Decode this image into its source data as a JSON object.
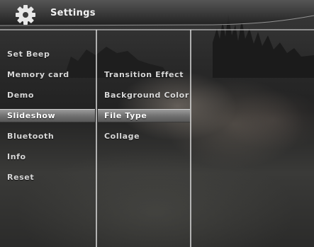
{
  "header": {
    "title": "Settings",
    "icon": "gear-icon"
  },
  "main_menu": {
    "items": [
      {
        "label": "Set Beep",
        "selected": false
      },
      {
        "label": "Memory card",
        "selected": false
      },
      {
        "label": "Demo",
        "selected": false
      },
      {
        "label": "Slideshow",
        "selected": true
      },
      {
        "label": "Bluetooth",
        "selected": false
      },
      {
        "label": "Info",
        "selected": false
      },
      {
        "label": "Reset",
        "selected": false
      }
    ]
  },
  "sub_menu": {
    "items": [
      {
        "label": "Transition Effect",
        "selected": false
      },
      {
        "label": "Background Color",
        "selected": false
      },
      {
        "label": "File Type",
        "selected": true
      },
      {
        "label": "Collage",
        "selected": false
      }
    ]
  },
  "colors": {
    "highlight": "#7a7a7a",
    "text": "#d8d8d8",
    "divider": "#dcdcdc"
  }
}
